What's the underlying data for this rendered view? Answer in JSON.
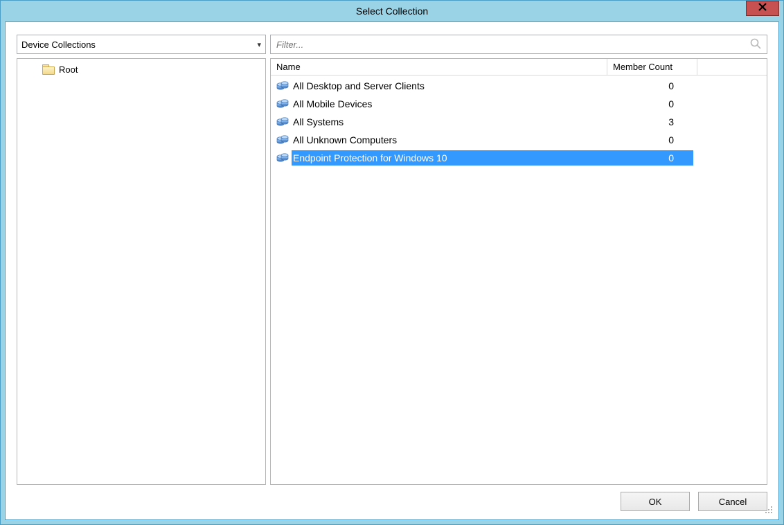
{
  "window": {
    "title": "Select Collection"
  },
  "left": {
    "combo_value": "Device Collections",
    "tree": {
      "root_label": "Root"
    }
  },
  "right": {
    "filter_placeholder": "Filter...",
    "columns": {
      "name": "Name",
      "count": "Member Count"
    },
    "rows": [
      {
        "name": "All Desktop and Server Clients",
        "count": "0",
        "selected": false
      },
      {
        "name": "All Mobile Devices",
        "count": "0",
        "selected": false
      },
      {
        "name": "All Systems",
        "count": "3",
        "selected": false
      },
      {
        "name": "All Unknown Computers",
        "count": "0",
        "selected": false
      },
      {
        "name": "Endpoint Protection for Windows 10",
        "count": "0",
        "selected": true
      }
    ]
  },
  "buttons": {
    "ok": "OK",
    "cancel": "Cancel"
  }
}
